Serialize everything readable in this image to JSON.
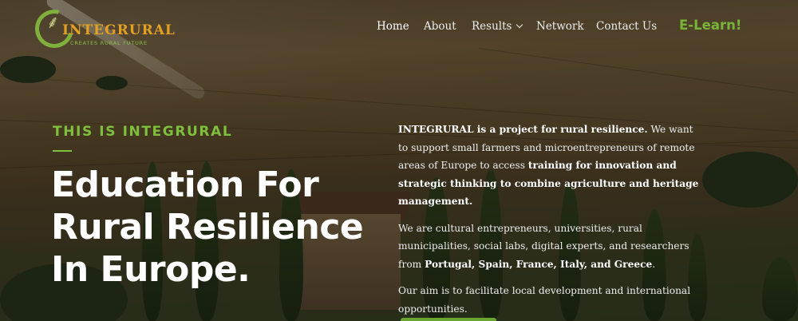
{
  "brand": {
    "name": "INTEGRURAL",
    "tagline": "CREATES RURAL FUTURE"
  },
  "nav": {
    "items": [
      {
        "label": "Home",
        "active": true
      },
      {
        "label": "About"
      },
      {
        "label": "Results",
        "has_dropdown": true
      },
      {
        "label": "Network"
      },
      {
        "label": "Contact Us"
      }
    ],
    "cta": "E-Learn!"
  },
  "hero": {
    "eyebrow": "THIS IS INTEGRURAL",
    "headline": [
      "Education For",
      "Rural Resilience",
      "In Europe."
    ],
    "p1": {
      "strong1": "INTEGRURAL is a project for rural resilience.",
      "text1": " We want to support small farmers and microentrepreneurs of remote areas of Europe to access ",
      "strong2": "training for innovation and strategic thinking to combine agriculture and heritage management."
    },
    "p2": {
      "text1": "We are cultural entrepreneurs, universities, rural municipalities, social labs, digital experts, and researchers from ",
      "strong1": "Portugal, Spain, France, Italy, and Greece",
      "text2": "."
    },
    "p3": "Our aim is to facilitate local development and international opportunities."
  },
  "colors": {
    "accent": "#7fbf3e",
    "logo_orange": "#e3a021",
    "text": "#ffffff"
  },
  "icons": {
    "logo": "wheat-ring-icon",
    "results_dropdown": "chevron-down-icon"
  }
}
